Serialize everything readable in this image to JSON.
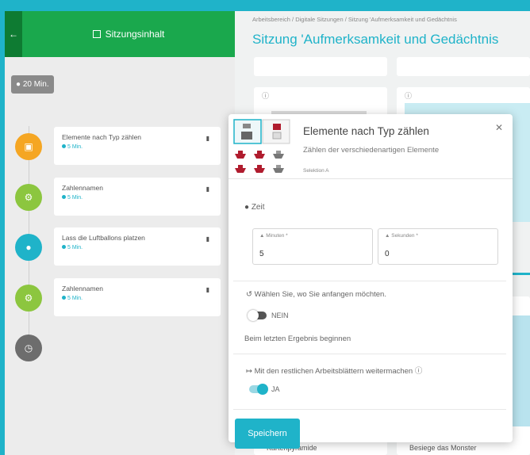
{
  "sidebar": {
    "back_icon": "arrow-left-icon",
    "title": "Sitzungsinhalt",
    "duration_badge": "20 Min.",
    "items": [
      {
        "title": "Elemente nach Typ zählen",
        "duration": "5 Min.",
        "color": "#f5a623",
        "icon": "calendar-icon"
      },
      {
        "title": "Zahlennamen",
        "duration": "5 Min.",
        "color": "#8cc63f",
        "icon": "gears-icon"
      },
      {
        "title": "Lass die Luftballons platzen",
        "duration": "5 Min.",
        "color": "#1fb3c9",
        "icon": "gamepad-icon"
      },
      {
        "title": "Zahlennamen",
        "duration": "5 Min.",
        "color": "#8cc63f",
        "icon": "gears-icon"
      }
    ],
    "end_icon": "clock-icon"
  },
  "header": {
    "breadcrumb": "Arbeitsbereich  /  Digitale Sitzungen  /  Sitzung 'Aufmerksamkeit und Gedächtnis",
    "title": "Sitzung 'Aufmerksamkeit und Gedächtnis"
  },
  "cards": {
    "labels": [
      "Kartenpyramide",
      "Besiege das Monster"
    ]
  },
  "modal": {
    "title": "Elemente nach Typ zählen",
    "subtitle": "Zählen der verschiedenartigen Elemente",
    "selection": "Selektion A",
    "time_label": "Zeit",
    "minutes_label": "Minuten *",
    "minutes_value": "5",
    "seconds_label": "Sekunden *",
    "seconds_value": "0",
    "start_question": "Wählen Sie, wo Sie anfangen möchten.",
    "start_toggle": "NEIN",
    "start_hint": "Beim letzten Ergebnis beginnen",
    "continue_label": "Mit den restlichen Arbeitsblättern weitermachen",
    "continue_toggle": "JA",
    "save_label": "Speichern",
    "accent": "#1fb3c9"
  }
}
